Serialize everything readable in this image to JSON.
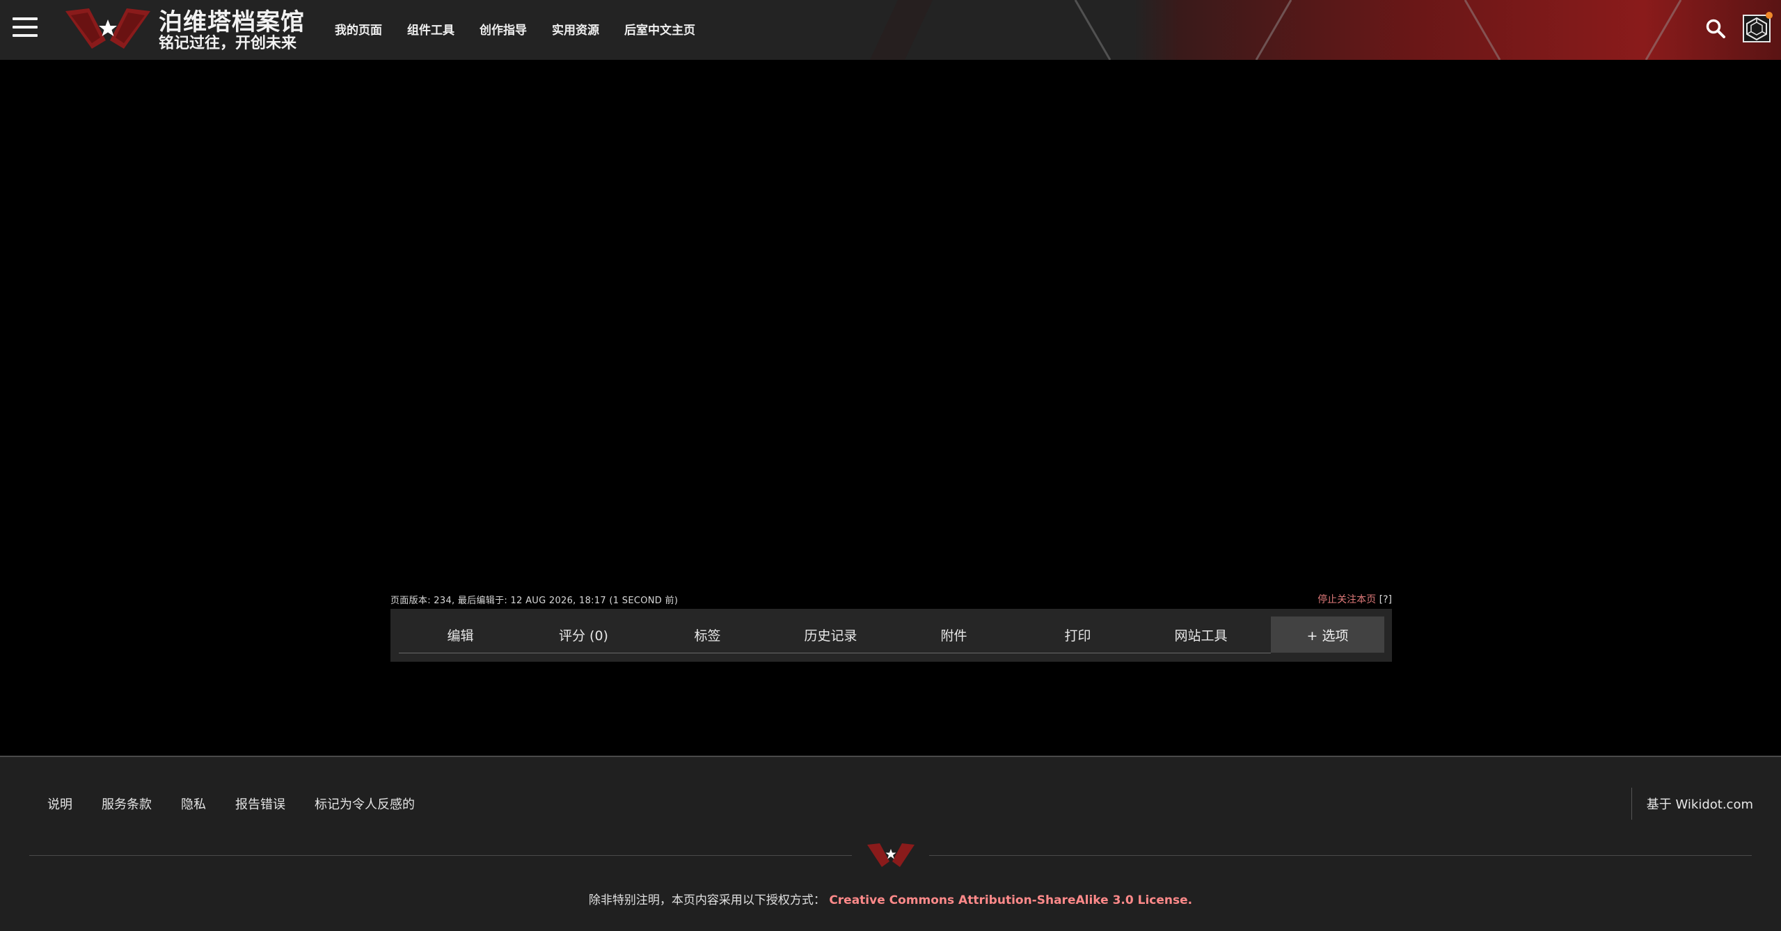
{
  "header": {
    "site_title": "泊维塔档案馆",
    "site_subtitle": "铭记过往，开创未来",
    "nav": [
      "我的页面",
      "组件工具",
      "创作指导",
      "实用资源",
      "后室中文主页"
    ]
  },
  "page_info": {
    "text": "页面版本: 234, 最后编辑于: 12 AUG 2026, 18:17 (1 SECOND 前)",
    "unwatch": "停止关注本页",
    "help": "[?]"
  },
  "actions": {
    "buttons": [
      "编辑",
      "评分 (0)",
      "标签",
      "历史记录",
      "附件",
      "打印",
      "网站工具"
    ],
    "options": "+ 选项"
  },
  "footer": {
    "links": [
      "说明",
      "服务条款",
      "隐私",
      "报告错误",
      "标记为令人反感的"
    ],
    "powered": "基于 Wikidot.com",
    "license_prefix": "除非特别注明，本页内容采用以下授权方式：",
    "license_link": "Creative Commons Attribution-ShareAlike 3.0 License."
  },
  "colors": {
    "header_bg": "#232323",
    "accent_red": "#8b1a1a",
    "link_red": "#e07a7a",
    "license_red": "#ff8a8a",
    "footer_bg": "#202020",
    "options_bg": "#424242"
  },
  "icons": [
    "hamburger-menu-icon",
    "star-emblem-logo",
    "search-icon",
    "account-cube-icon",
    "notification-dot-icon"
  ]
}
